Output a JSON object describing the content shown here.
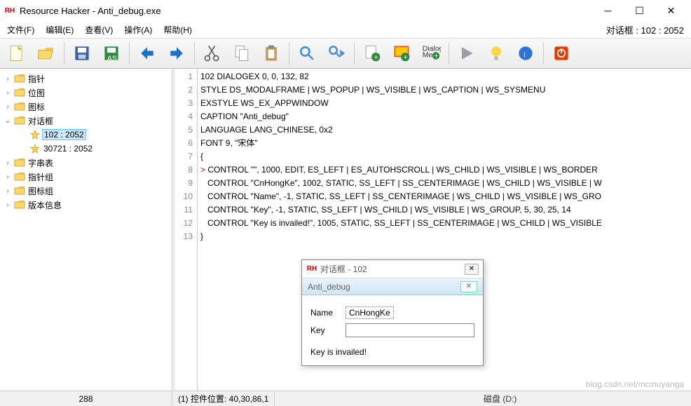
{
  "title": "Resource Hacker - Anti_debug.exe",
  "menu": {
    "file": "文件(F)",
    "edit": "编辑(E)",
    "view": "查看(V)",
    "action": "操作(A)",
    "help": "帮助(H)"
  },
  "menubar_right": "对话框 : 102 : 2052",
  "toolbar_icons": [
    "new",
    "open",
    "save",
    "save-as",
    "undo",
    "redo",
    "cut",
    "copy",
    "paste",
    "find",
    "find-next",
    "add-res",
    "replace-res",
    "dialog-merge",
    "play",
    "bulb",
    "info",
    "stop"
  ],
  "tree": {
    "items": [
      {
        "label": "指针",
        "depth": 0,
        "twisty": ">",
        "icon": "folder"
      },
      {
        "label": "位图",
        "depth": 0,
        "twisty": ">",
        "icon": "folder"
      },
      {
        "label": "图标",
        "depth": 0,
        "twisty": ">",
        "icon": "folder"
      },
      {
        "label": "对话框",
        "depth": 0,
        "twisty": "v",
        "icon": "folder"
      },
      {
        "label": "102 : 2052",
        "depth": 1,
        "twisty": "",
        "icon": "star",
        "selected": true
      },
      {
        "label": "30721 : 2052",
        "depth": 1,
        "twisty": "",
        "icon": "star"
      },
      {
        "label": "字串表",
        "depth": 0,
        "twisty": ">",
        "icon": "folder"
      },
      {
        "label": "指针组",
        "depth": 0,
        "twisty": ">",
        "icon": "folder"
      },
      {
        "label": "图标组",
        "depth": 0,
        "twisty": ">",
        "icon": "folder"
      },
      {
        "label": "版本信息",
        "depth": 0,
        "twisty": ">",
        "icon": "folder"
      }
    ]
  },
  "code": {
    "lines": [
      "102 DIALOGEX 0, 0, 132, 82",
      "STYLE DS_MODALFRAME | WS_POPUP | WS_VISIBLE | WS_CAPTION | WS_SYSMENU",
      "EXSTYLE WS_EX_APPWINDOW",
      "CAPTION \"Anti_debug\"",
      "LANGUAGE LANG_CHINESE, 0x2",
      "FONT 9, \"宋体\"",
      "{",
      "   CONTROL \"\", 1000, EDIT, ES_LEFT | ES_AUTOHSCROLL | WS_CHILD | WS_VISIBLE | WS_BORDER",
      "   CONTROL \"CnHongKe\", 1002, STATIC, SS_LEFT | SS_CENTERIMAGE | WS_CHILD | WS_VISIBLE | W",
      "   CONTROL \"Name\", -1, STATIC, SS_LEFT | SS_CENTERIMAGE | WS_CHILD | WS_VISIBLE | WS_GRO",
      "   CONTROL \"Key\", -1, STATIC, SS_LEFT | WS_CHILD | WS_VISIBLE | WS_GROUP, 5, 30, 25, 14",
      "   CONTROL \"Key is invailed!\", 1005, STATIC, SS_LEFT | SS_CENTERIMAGE | WS_CHILD | WS_VISIBLE",
      "}"
    ],
    "highlight_line": 8,
    "marker": "> "
  },
  "status": {
    "left": "288",
    "right": "(1) 控件位置: 40,30,86,1"
  },
  "preview": {
    "frame_title": "对话框 - 102",
    "caption": "Anti_debug",
    "name_label": "Name",
    "name_value": "CnHongKe",
    "key_label": "Key",
    "key_value": "",
    "msg": "Key is invailed!"
  },
  "footer_extra": "磁盘 (D:)",
  "watermark": "blog.csdn.net/mcmuyanga"
}
